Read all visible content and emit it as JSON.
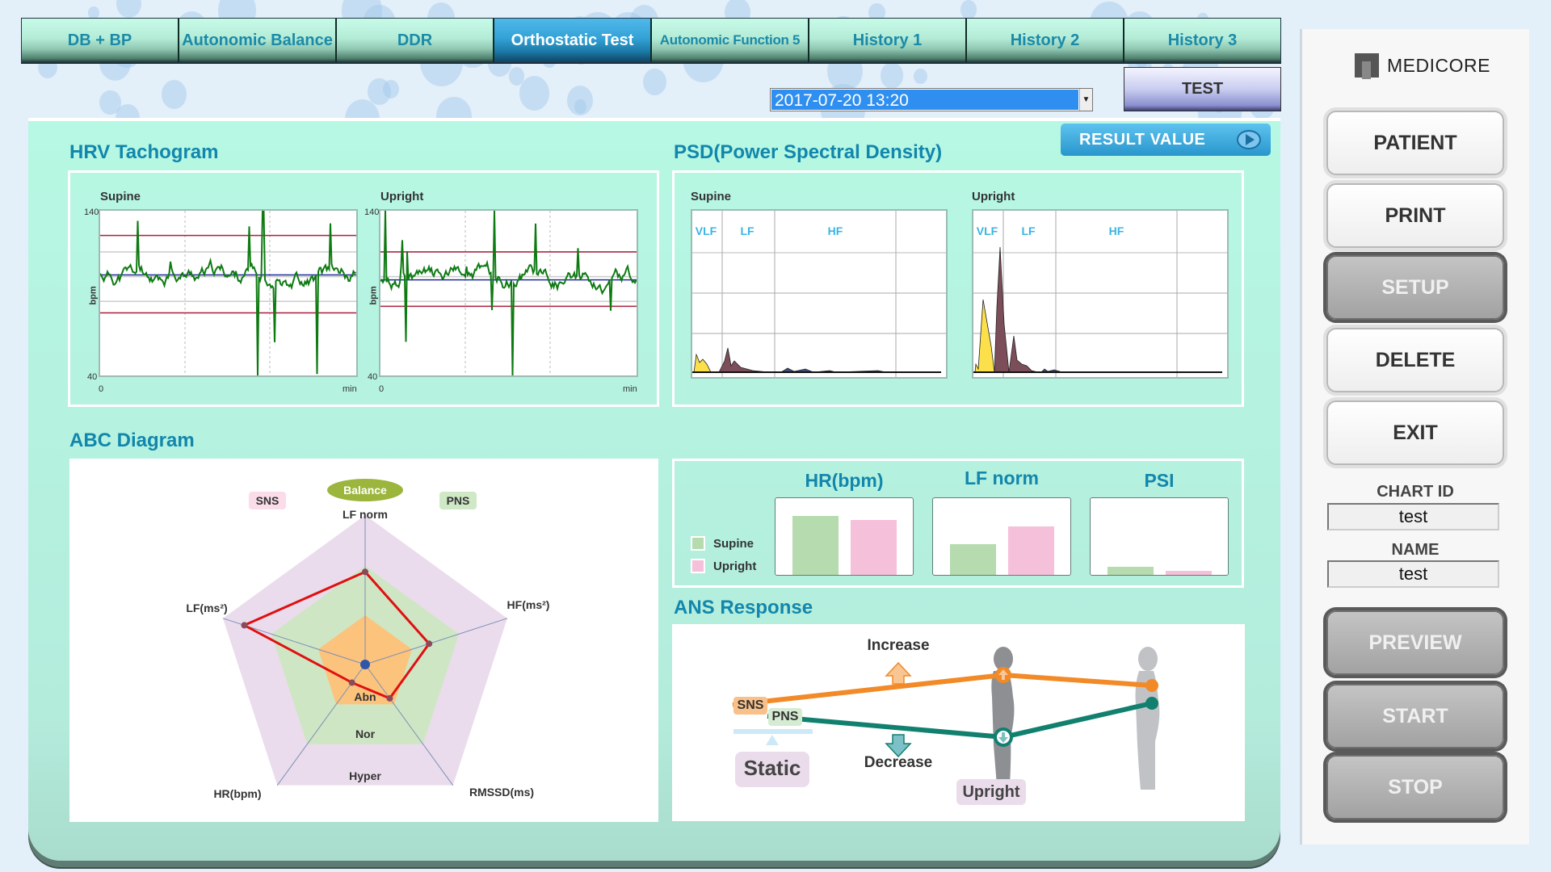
{
  "tabs": [
    {
      "label": "DB + BP",
      "active": false
    },
    {
      "label": "Autonomic Balance",
      "active": false
    },
    {
      "label": "DDR",
      "active": false
    },
    {
      "label": "Orthostatic Test",
      "active": true
    },
    {
      "label": "Autonomic Function 5",
      "active": false
    },
    {
      "label": "History 1",
      "active": false
    },
    {
      "label": "History 2",
      "active": false
    },
    {
      "label": "History 3",
      "active": false
    }
  ],
  "date_select": {
    "value": "2017-07-20 13:20"
  },
  "test_button": "TEST",
  "result_value_button": "RESULT VALUE",
  "hrv": {
    "title": "HRV Tachogram",
    "supine_label": "Supine",
    "upright_label": "Upright",
    "y_max": "140",
    "y_min": "40",
    "x_start": "0",
    "x_unit": "min",
    "y_unit": "bpm"
  },
  "psd": {
    "title": "PSD(Power Spectral Density)",
    "supine_label": "Supine",
    "upright_label": "Upright",
    "bands": [
      "VLF",
      "LF",
      "HF"
    ]
  },
  "abc": {
    "title": "ABC Diagram",
    "balance_label": "Balance",
    "sns_label": "SNS",
    "pns_label": "PNS",
    "axes": [
      "LF norm",
      "HF(ms²)",
      "RMSSD(ms)",
      "HR(bpm)",
      "LF(ms²)"
    ],
    "zones": [
      "Abn",
      "Nor",
      "Hyper"
    ],
    "values": [
      0.62,
      0.45,
      0.28,
      0.15,
      0.85
    ]
  },
  "bars": {
    "legend": [
      "Supine",
      "Upright"
    ],
    "colors": {
      "supine": "#b5dbae",
      "upright": "#f5c0d9"
    },
    "charts": [
      {
        "title": "HR(bpm)",
        "supine": 0.77,
        "upright": 0.72
      },
      {
        "title": "LF norm",
        "supine": 0.4,
        "upright": 0.63
      },
      {
        "title": "PSI",
        "supine": 0.11,
        "upright": 0.05
      }
    ]
  },
  "ans": {
    "title": "ANS Response",
    "increase_label": "Increase",
    "decrease_label": "Decrease",
    "sns_label": "SNS",
    "pns_label": "PNS",
    "static_label": "Static",
    "upright_label": "Upright"
  },
  "sidebar": {
    "logo": "MEDICORE",
    "buttons_top": [
      "PATIENT",
      "PRINT",
      "SETUP",
      "DELETE",
      "EXIT"
    ],
    "chart_id_label": "CHART ID",
    "chart_id_value": "test",
    "name_label": "NAME",
    "name_value": "test",
    "buttons_bottom": [
      "PREVIEW",
      "START",
      "STOP"
    ]
  }
}
